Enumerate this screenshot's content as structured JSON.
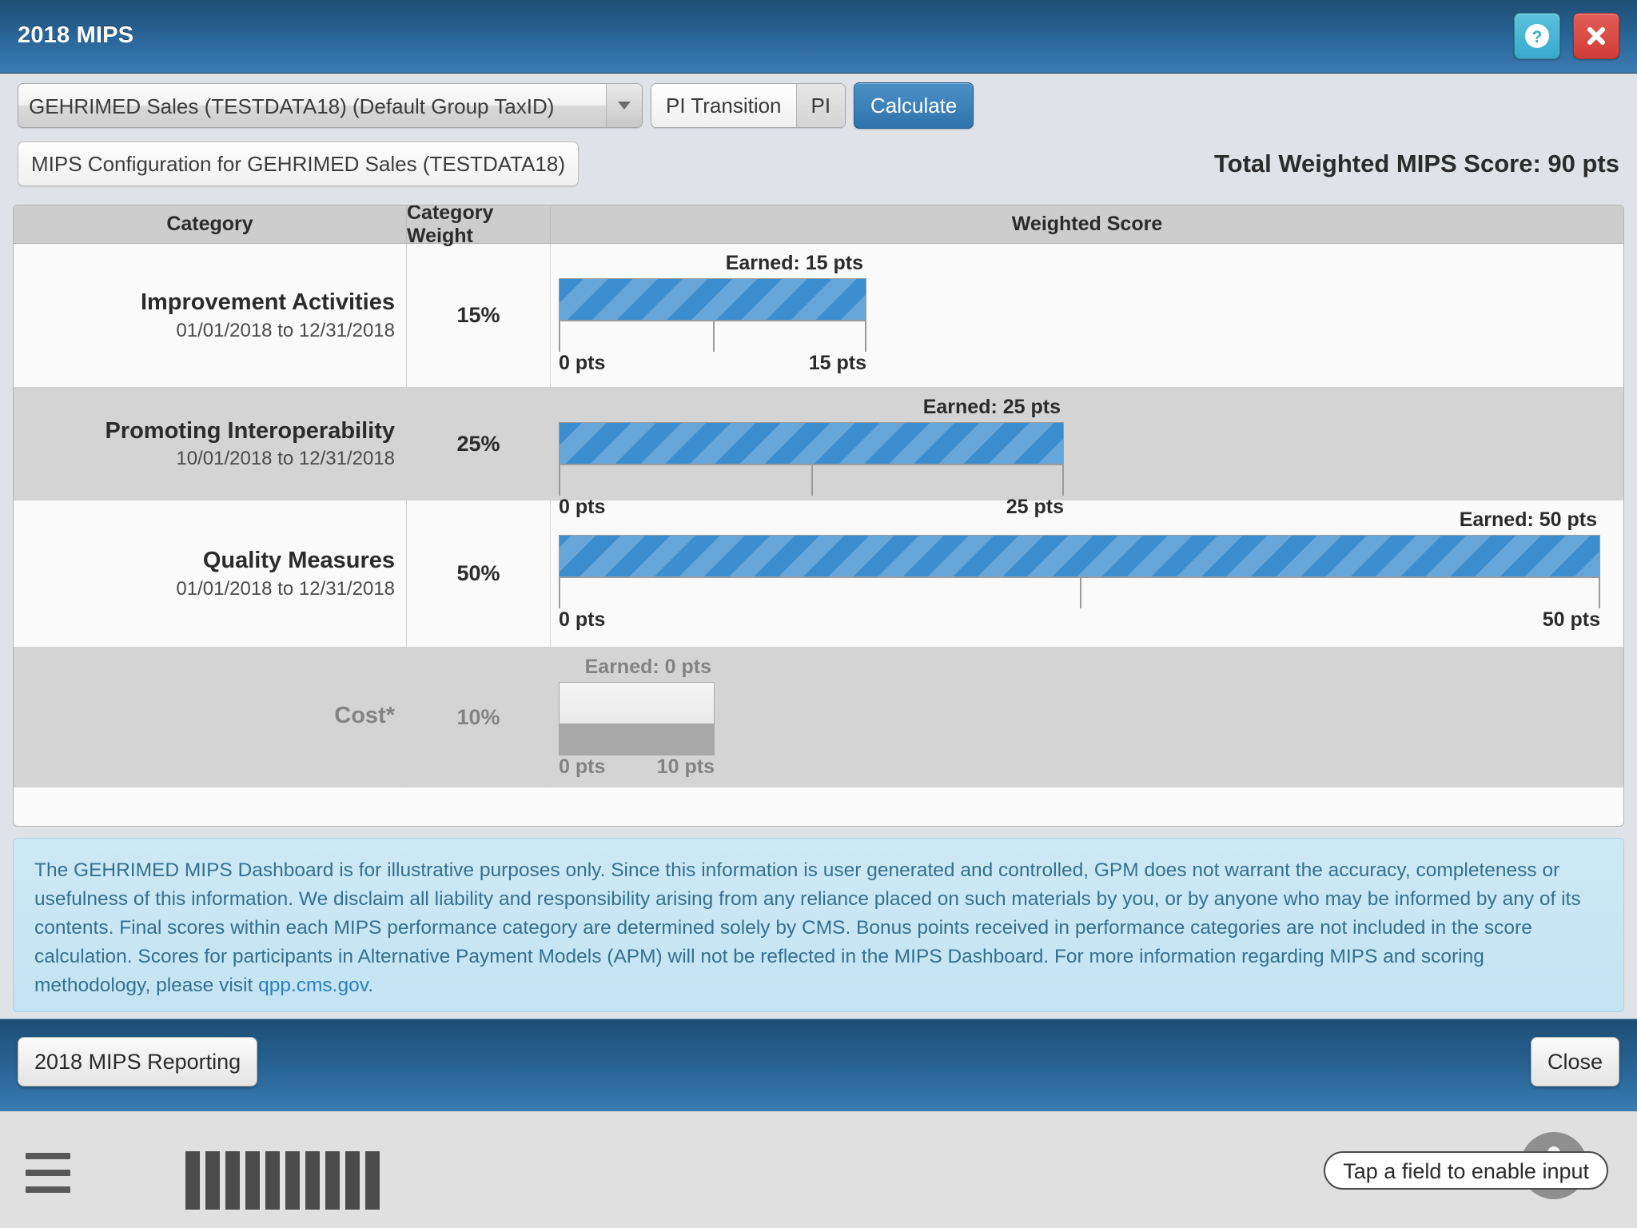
{
  "titlebar": {
    "title": "2018 MIPS",
    "help_label": "?",
    "close_label": "✖"
  },
  "toolbar": {
    "group_select_value": "GEHRIMED Sales (TESTDATA18) (Default Group TaxID)",
    "segmented": [
      {
        "label": "PI Transition",
        "selected": true
      },
      {
        "label": "PI",
        "selected": false
      }
    ],
    "calculate_label": "Calculate",
    "config_label": "MIPS Configuration for GEHRIMED Sales (TESTDATA18)",
    "total_score_label": "Total Weighted MIPS Score: 90 pts"
  },
  "table": {
    "headers": [
      "Category",
      "Category Weight",
      "Weighted Score"
    ],
    "rows": [
      {
        "category": "Improvement Activities",
        "dates": "01/01/2018 to 12/31/2018",
        "weight": "15%",
        "earned_label": "Earned: 15 pts",
        "axis_min_label": "0 pts",
        "axis_max_label": "15 pts",
        "disabled": false
      },
      {
        "category": "Promoting Interoperability",
        "dates": "10/01/2018 to 12/31/2018",
        "weight": "25%",
        "earned_label": "Earned: 25 pts",
        "axis_min_label": "0 pts",
        "axis_max_label": "25 pts",
        "disabled": false
      },
      {
        "category": "Quality Measures",
        "dates": "01/01/2018 to 12/31/2018",
        "weight": "50%",
        "earned_label": "Earned: 50 pts",
        "axis_min_label": "0 pts",
        "axis_max_label": "50 pts",
        "disabled": false
      },
      {
        "category": "Cost*",
        "dates": "",
        "weight": "10%",
        "earned_label": "Earned: 0 pts",
        "axis_min_label": "0 pts",
        "axis_max_label": "10 pts",
        "disabled": true
      }
    ]
  },
  "chart_data": {
    "type": "bar",
    "title": "Weighted Score",
    "orientation": "horizontal",
    "xlabel": "pts",
    "categories": [
      "Improvement Activities",
      "Promoting Interoperability",
      "Quality Measures",
      "Cost*"
    ],
    "values": [
      15,
      25,
      50,
      0
    ],
    "max_values": [
      15,
      25,
      50,
      10
    ],
    "weights_pct": [
      15,
      25,
      50,
      10
    ],
    "total_weighted_score": 90,
    "bar_color": "#3c8dcd",
    "bar_pattern": "diagonal-stripes",
    "empty_bar_color": "#eeeeee",
    "axis_tick_labels": [
      [
        "0 pts",
        "15 pts"
      ],
      [
        "0 pts",
        "25 pts"
      ],
      [
        "0 pts",
        "50 pts"
      ],
      [
        "0 pts",
        "10 pts"
      ]
    ],
    "grid": false,
    "legend": "none"
  },
  "disclaimer": {
    "text_part1": "The GEHRIMED MIPS Dashboard is for illustrative purposes only. Since this information is user generated and controlled, GPM does not warrant the accuracy, completeness or usefulness of this information. We disclaim all liability and responsibility arising from any reliance placed on such materials by you, or by anyone who may be informed by any of its contents. Final scores within each MIPS performance category are determined solely by CMS. Bonus points received in performance categories are not included in the score calculation. Scores for participants in Alternative Payment Models (APM) will not be reflected in the MIPS Dashboard. For more information regarding MIPS and scoring methodology, please visit ",
    "link_text": "qpp.cms.gov",
    "text_part2": "."
  },
  "footer": {
    "reporting_label": "2018 MIPS Reporting",
    "close_label": "Close"
  },
  "keyboard_bar": {
    "tap_hint": "Tap a field to enable input"
  }
}
